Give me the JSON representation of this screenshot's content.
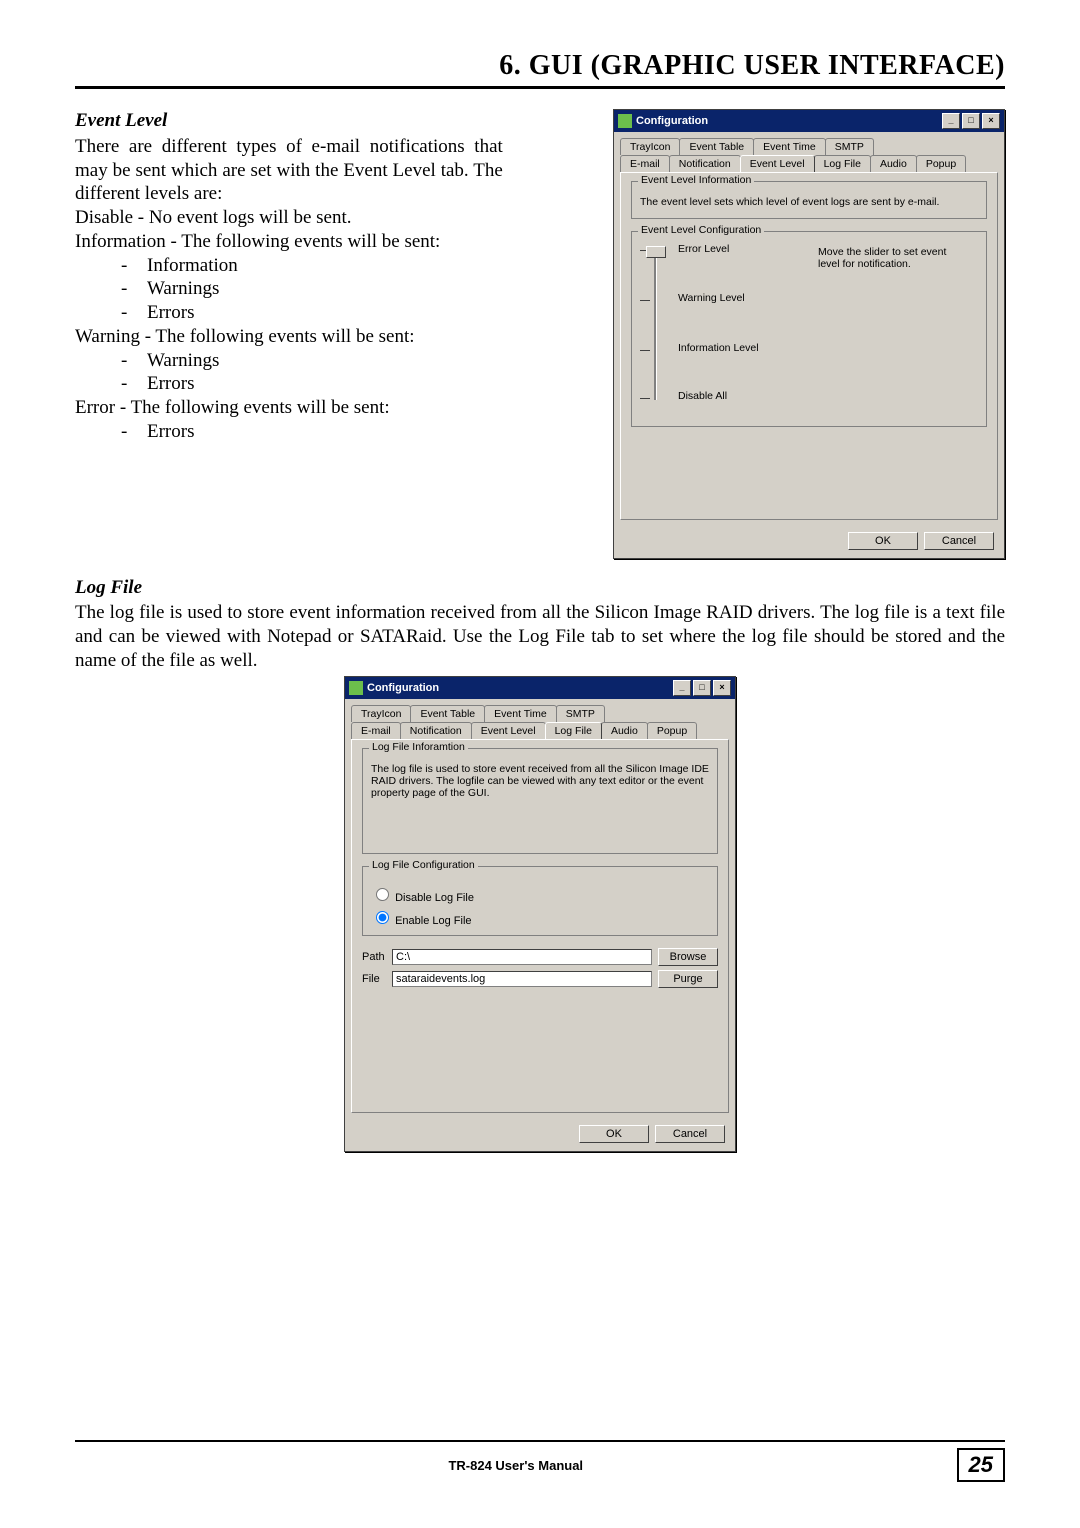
{
  "header": {
    "title": "6. GUI (GRAPHIC USER INTERFACE)"
  },
  "event_level": {
    "heading": "Event Level",
    "intro": "There are different types of e-mail notifications that may be sent which are set with the Event Level tab. The different levels are:",
    "line_disable": "Disable - No event logs will be sent.",
    "line_info": "Information - The following events will be sent:",
    "info_items": [
      "Information",
      "Warnings",
      "Errors"
    ],
    "line_warn": "Warning - The following events will be sent:",
    "warn_items": [
      "Warnings",
      "Errors"
    ],
    "line_err": "Error - The following events will be sent:",
    "err_items": [
      "Errors"
    ]
  },
  "win1": {
    "title": "Configuration",
    "tabs_row1": [
      "TrayIcon",
      "Event Table",
      "Event Time",
      "SMTP"
    ],
    "tabs_row2": [
      "E-mail",
      "Notification",
      "Event Level",
      "Log File",
      "Audio",
      "Popup"
    ],
    "active_tab": "Event Level",
    "grp1_title": "Event Level Information",
    "grp1_text": "The event level sets which level of event logs are sent by e-mail.",
    "grp2_title": "Event Level Configuration",
    "slider_labels": [
      "Error Level",
      "Warning Level",
      "Information Level",
      "Disable All"
    ],
    "hint": "Move the slider to set event level for notification.",
    "ok": "OK",
    "cancel": "Cancel"
  },
  "log_file": {
    "heading": "Log File",
    "text": "The log file is used to store event information received from all the Silicon Image RAID drivers. The log file is a text file and can be viewed with Notepad or SATARaid. Use the Log File tab to set where the log file should be stored and the name of the file as well."
  },
  "win2": {
    "title": "Configuration",
    "tabs_row1": [
      "TrayIcon",
      "Event Table",
      "Event Time",
      "SMTP"
    ],
    "tabs_row2": [
      "E-mail",
      "Notification",
      "Event Level",
      "Log File",
      "Audio",
      "Popup"
    ],
    "active_tab": "Log File",
    "grp1_title": "Log File Inforamtion",
    "grp1_text": "The log file is used to store event received from all the Silicon Image IDE RAID drivers. The logfile can be viewed with any text editor or the event property page of the GUI.",
    "grp2_title": "Log File Configuration",
    "radio_disable": "Disable Log File",
    "radio_enable": "Enable Log File",
    "path_label": "Path",
    "path_value": "C:\\",
    "file_label": "File",
    "file_value": "sataraidevents.log",
    "browse": "Browse",
    "purge": "Purge",
    "ok": "OK",
    "cancel": "Cancel"
  },
  "footer": {
    "text": "TR-824 User's Manual",
    "page": "25"
  }
}
